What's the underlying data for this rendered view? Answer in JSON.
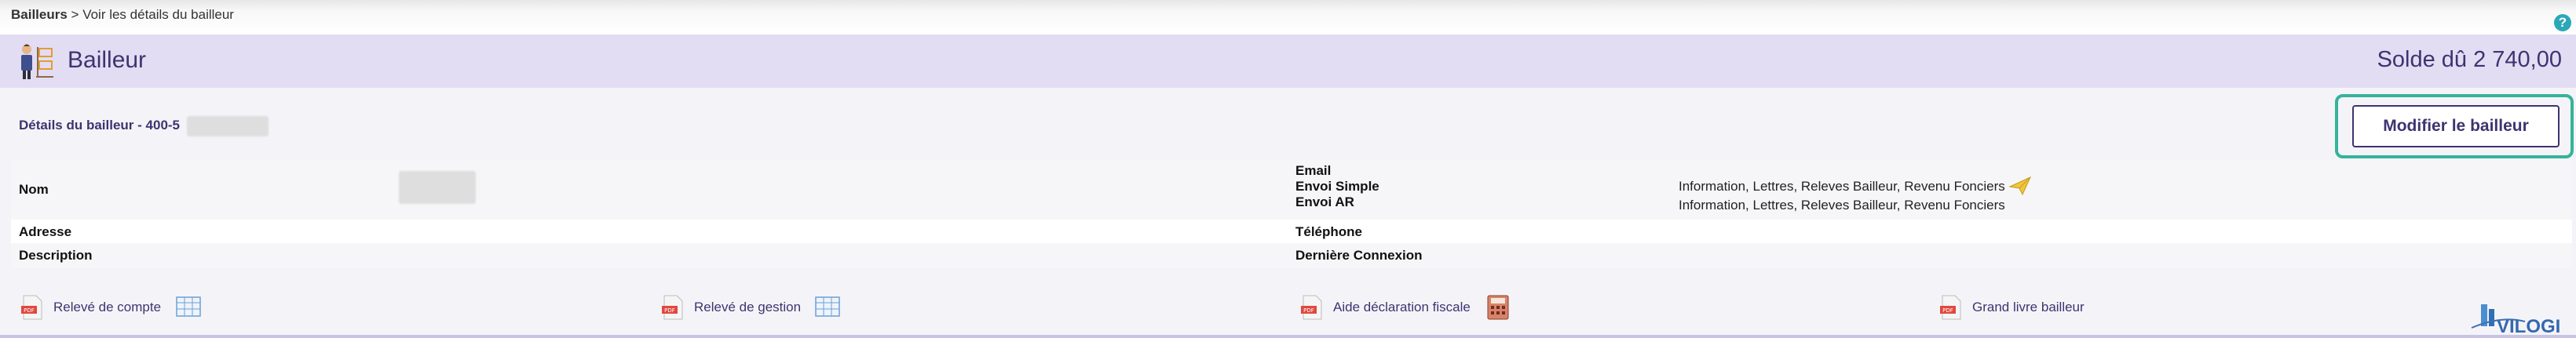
{
  "breadcrumb": {
    "root": "Bailleurs",
    "separator": " > ",
    "current": "Voir les détails du bailleur"
  },
  "help": {
    "glyph": "?",
    "icon": "help-icon"
  },
  "header": {
    "title": "Bailleur",
    "balance": "Solde dû 2 740,00",
    "icon": "landlord-icon"
  },
  "details": {
    "title": "Détails du bailleur - 400-5"
  },
  "actions": {
    "edit_label": "Modifier le bailleur"
  },
  "fields": {
    "nom_label": "Nom",
    "adresse_label": "Adresse",
    "description_label": "Description",
    "email_label": "Email",
    "envoi_simple_label": "Envoi Simple",
    "envoi_ar_label": "Envoi AR",
    "telephone_label": "Téléphone",
    "derniere_connexion_label": "Dernière Connexion",
    "envoi_simple_value": "Information, Lettres, Releves Bailleur, Revenu Fonciers",
    "envoi_ar_value": "Information, Lettres, Releves Bailleur, Revenu Fonciers"
  },
  "reports": [
    {
      "label": "Relevé de compte",
      "icon": "pdf-icon",
      "extra_icon": "spreadsheet-icon"
    },
    {
      "label": "Relevé de gestion",
      "icon": "pdf-icon",
      "extra_icon": "spreadsheet-icon"
    },
    {
      "label": "Aide déclaration fiscale",
      "icon": "pdf-icon",
      "extra_icon": "calculator-icon"
    },
    {
      "label": "Grand livre bailleur",
      "icon": "pdf-icon"
    }
  ],
  "logo": {
    "text": "VILOGI"
  },
  "colors": {
    "accent": "#3d3470",
    "header_bg": "#e2ddf3",
    "focus": "#36b39a",
    "help": "#2aa8b8"
  }
}
